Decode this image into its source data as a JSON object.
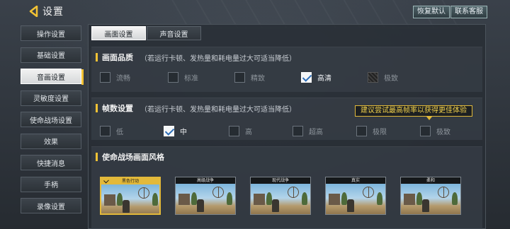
{
  "header": {
    "title": "设置",
    "restore_label": "恢复默认",
    "support_label": "联系客服"
  },
  "sidebar": {
    "items": [
      {
        "label": "操作设置",
        "active": false
      },
      {
        "label": "基础设置",
        "active": false
      },
      {
        "label": "音画设置",
        "active": true
      },
      {
        "label": "灵敏度设置",
        "active": false
      },
      {
        "label": "使命战场设置",
        "active": false
      },
      {
        "label": "效果",
        "active": false
      },
      {
        "label": "快捷消息",
        "active": false
      },
      {
        "label": "手柄",
        "active": false
      },
      {
        "label": "录像设置",
        "active": false
      }
    ]
  },
  "tabs": [
    {
      "label": "画面设置",
      "active": true
    },
    {
      "label": "声音设置",
      "active": false
    }
  ],
  "quality": {
    "title": "画面品质",
    "note": "（若运行卡顿、发热量和耗电量过大可适当降低）",
    "options": [
      {
        "label": "流畅",
        "state": "unchecked"
      },
      {
        "label": "标准",
        "state": "unchecked"
      },
      {
        "label": "精致",
        "state": "unchecked"
      },
      {
        "label": "高清",
        "state": "checked"
      },
      {
        "label": "极致",
        "state": "disabled"
      }
    ]
  },
  "fps": {
    "title": "帧数设置",
    "note": "（若运行卡顿、发热量和耗电量过大可适当降低）",
    "tooltip": "建议尝试最高帧率以获得更佳体验",
    "options": [
      {
        "label": "低",
        "state": "unchecked"
      },
      {
        "label": "中",
        "state": "checked"
      },
      {
        "label": "高",
        "state": "unchecked"
      },
      {
        "label": "超高",
        "state": "unchecked"
      },
      {
        "label": "极限",
        "state": "unchecked"
      },
      {
        "label": "极致",
        "state": "unchecked"
      }
    ]
  },
  "style": {
    "title": "使命战场画面风格",
    "options": [
      {
        "label": "黑色行动",
        "selected": true
      },
      {
        "label": "高级战争",
        "selected": false
      },
      {
        "label": "现代战争",
        "selected": false
      },
      {
        "label": "真实",
        "selected": false
      },
      {
        "label": "柔和",
        "selected": false
      }
    ]
  },
  "colors": {
    "accent": "#f2c234",
    "active_item": "#f2f2f2",
    "check": "#2f6fb8"
  }
}
